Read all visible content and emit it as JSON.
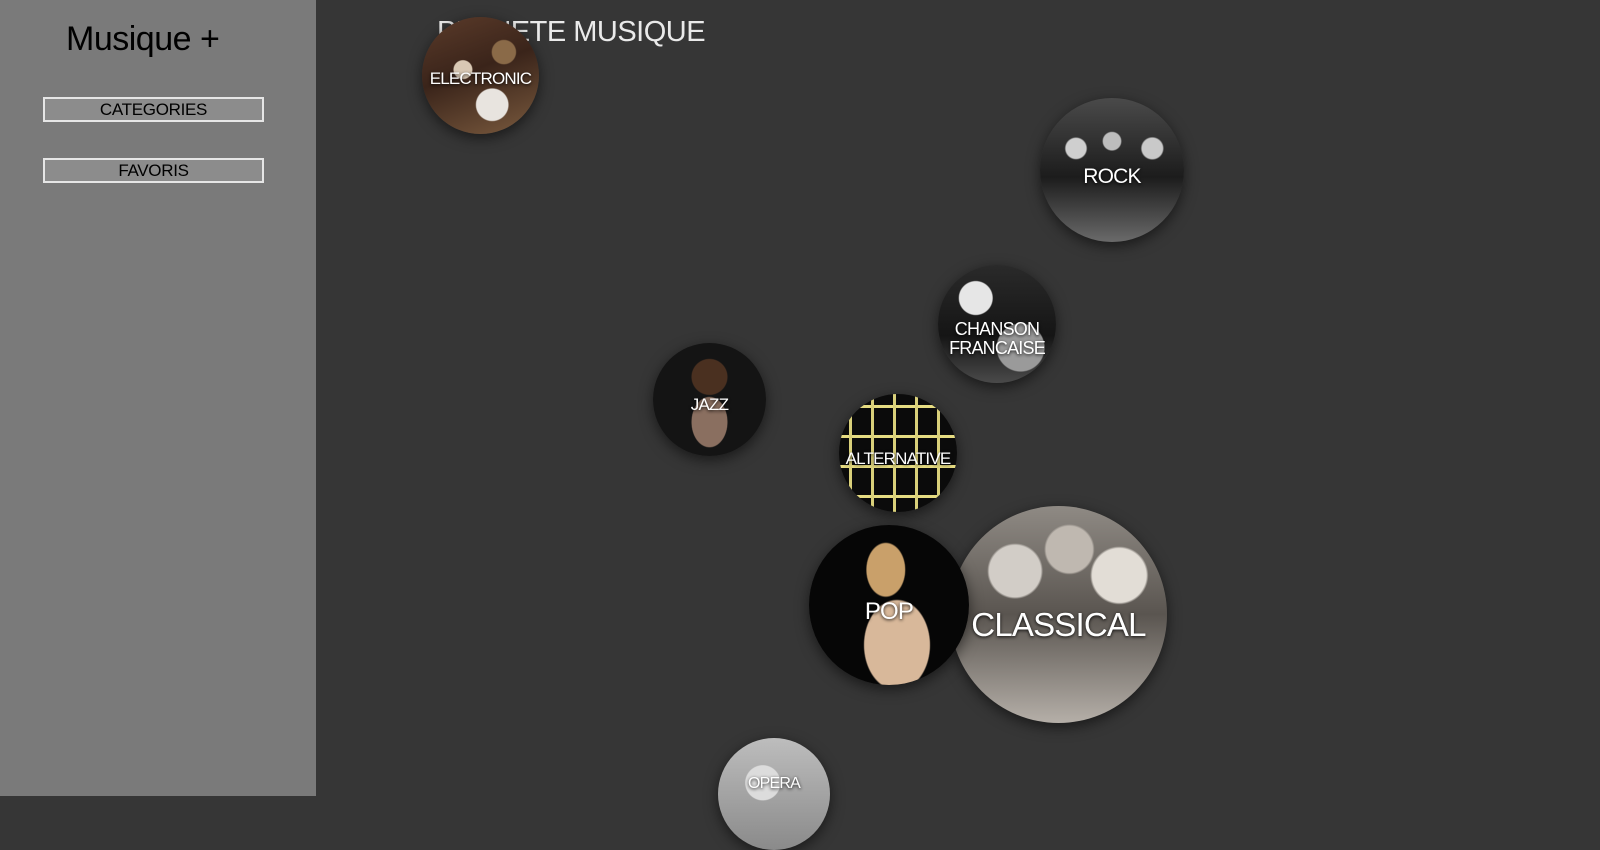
{
  "sidebar": {
    "app_title": "Musique +",
    "nav": [
      {
        "label": "CATEGORIES"
      },
      {
        "label": "FAVORIS"
      }
    ]
  },
  "main": {
    "heading": "PLANETE MUSIQUE",
    "genres": [
      {
        "label": "ELECTRONIC"
      },
      {
        "label": "ROCK"
      },
      {
        "label": "CHANSON\nFRANCAISE"
      },
      {
        "label": "JAZZ"
      },
      {
        "label": "ALTERNATIVE"
      },
      {
        "label": "POP"
      },
      {
        "label": "CLASSICAL"
      },
      {
        "label": "OPERA"
      }
    ]
  },
  "colors": {
    "sidebar_bg": "#7a7a7a",
    "main_bg": "#363636",
    "button_bg": "#8c8c8c",
    "button_border": "#e6e6e6",
    "label_text": "#ffffff"
  }
}
